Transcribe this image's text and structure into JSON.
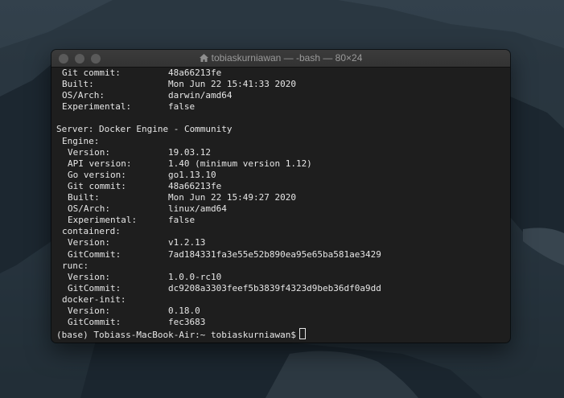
{
  "window": {
    "title": "tobiaskurniawan — -bash — 80×24"
  },
  "terminal_lines": [
    {
      "indent": 1,
      "key": "Git commit:",
      "value": "48a66213fe"
    },
    {
      "indent": 1,
      "key": "Built:",
      "value": "Mon Jun 22 15:41:33 2020"
    },
    {
      "indent": 1,
      "key": "OS/Arch:",
      "value": "darwin/amd64"
    },
    {
      "indent": 1,
      "key": "Experimental:",
      "value": "false"
    },
    {
      "indent": 0,
      "key": "",
      "value": ""
    },
    {
      "indent": 0,
      "key": "Server: Docker Engine - Community",
      "value": ""
    },
    {
      "indent": 1,
      "key": "Engine:",
      "value": ""
    },
    {
      "indent": 2,
      "key": "Version:",
      "value": "19.03.12"
    },
    {
      "indent": 2,
      "key": "API version:",
      "value": "1.40 (minimum version 1.12)"
    },
    {
      "indent": 2,
      "key": "Go version:",
      "value": "go1.13.10"
    },
    {
      "indent": 2,
      "key": "Git commit:",
      "value": "48a66213fe"
    },
    {
      "indent": 2,
      "key": "Built:",
      "value": "Mon Jun 22 15:49:27 2020"
    },
    {
      "indent": 2,
      "key": "OS/Arch:",
      "value": "linux/amd64"
    },
    {
      "indent": 2,
      "key": "Experimental:",
      "value": "false"
    },
    {
      "indent": 1,
      "key": "containerd:",
      "value": ""
    },
    {
      "indent": 2,
      "key": "Version:",
      "value": "v1.2.13"
    },
    {
      "indent": 2,
      "key": "GitCommit:",
      "value": "7ad184331fa3e55e52b890ea95e65ba581ae3429"
    },
    {
      "indent": 1,
      "key": "runc:",
      "value": ""
    },
    {
      "indent": 2,
      "key": "Version:",
      "value": "1.0.0-rc10"
    },
    {
      "indent": 2,
      "key": "GitCommit:",
      "value": "dc9208a3303feef5b3839f4323d9beb36df0a9dd"
    },
    {
      "indent": 1,
      "key": "docker-init:",
      "value": ""
    },
    {
      "indent": 2,
      "key": "Version:",
      "value": "0.18.0"
    },
    {
      "indent": 2,
      "key": "GitCommit:",
      "value": "fec3683"
    }
  ],
  "prompt": "(base) Tobiass-MacBook-Air:~ tobiaskurniawan$",
  "colors": {
    "terminal_bg": "#1e1e1e",
    "text": "#e6e6e6",
    "titlebar": "#363636"
  }
}
